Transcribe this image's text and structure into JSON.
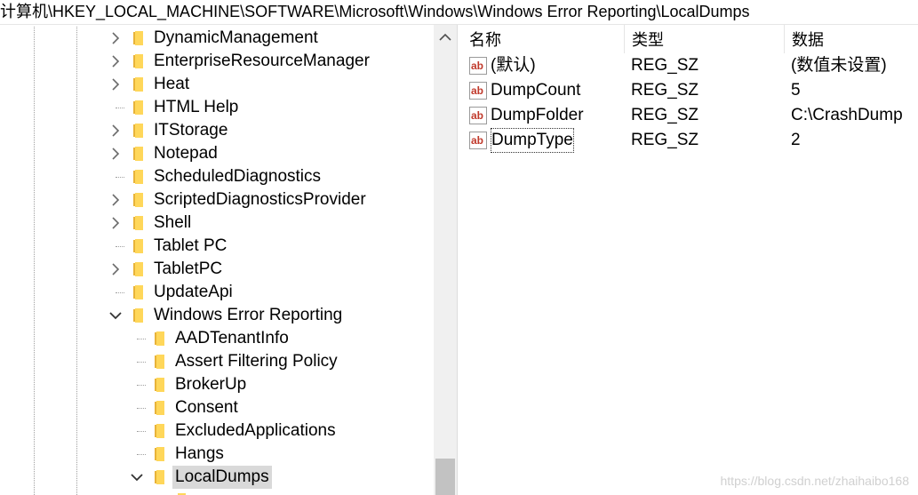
{
  "address_bar": {
    "path": "计算机\\HKEY_LOCAL_MACHINE\\SOFTWARE\\Microsoft\\Windows\\Windows Error Reporting\\LocalDumps"
  },
  "tree": {
    "items": [
      {
        "label": "DynamicManagement",
        "expander": "collapsed",
        "level": 1
      },
      {
        "label": "EnterpriseResourceManager",
        "expander": "collapsed",
        "level": 1
      },
      {
        "label": "Heat",
        "expander": "collapsed",
        "level": 1
      },
      {
        "label": "HTML Help",
        "expander": "none",
        "level": 1
      },
      {
        "label": "ITStorage",
        "expander": "collapsed",
        "level": 1
      },
      {
        "label": "Notepad",
        "expander": "collapsed",
        "level": 1
      },
      {
        "label": "ScheduledDiagnostics",
        "expander": "none",
        "level": 1
      },
      {
        "label": "ScriptedDiagnosticsProvider",
        "expander": "collapsed",
        "level": 1
      },
      {
        "label": "Shell",
        "expander": "collapsed",
        "level": 1
      },
      {
        "label": "Tablet PC",
        "expander": "none",
        "level": 1
      },
      {
        "label": "TabletPC",
        "expander": "collapsed",
        "level": 1
      },
      {
        "label": "UpdateApi",
        "expander": "none",
        "level": 1
      },
      {
        "label": "Windows Error Reporting",
        "expander": "expanded",
        "level": 1
      },
      {
        "label": "AADTenantInfo",
        "expander": "none",
        "level": 2
      },
      {
        "label": "Assert Filtering Policy",
        "expander": "none",
        "level": 2
      },
      {
        "label": "BrokerUp",
        "expander": "none",
        "level": 2
      },
      {
        "label": "Consent",
        "expander": "none",
        "level": 2
      },
      {
        "label": "ExcludedApplications",
        "expander": "none",
        "level": 2
      },
      {
        "label": "Hangs",
        "expander": "none",
        "level": 2
      },
      {
        "label": "LocalDumps",
        "expander": "expanded",
        "level": 2,
        "selected": true
      }
    ]
  },
  "values_pane": {
    "headers": {
      "name": "名称",
      "type": "类型",
      "data": "数据"
    },
    "rows": [
      {
        "name": "(默认)",
        "type": "REG_SZ",
        "data": "(数值未设置)"
      },
      {
        "name": "DumpCount",
        "type": "REG_SZ",
        "data": "5"
      },
      {
        "name": "DumpFolder",
        "type": "REG_SZ",
        "data": "C:\\CrashDump"
      },
      {
        "name": "DumpType",
        "type": "REG_SZ",
        "data": "2",
        "focused": true
      }
    ]
  },
  "watermark": "https://blog.csdn.net/zhaihaibo168",
  "colors": {
    "folder": "#ffd75a",
    "folder_dark": "#e8b339",
    "selection": "#d9d9d9",
    "ab_icon": "#c0392b"
  },
  "icons": {
    "folder": "folder-icon",
    "string_value": "reg-sz-icon",
    "collapsed": "chevron-right-icon",
    "expanded": "chevron-down-icon",
    "scroll_up": "chevron-up-icon"
  }
}
